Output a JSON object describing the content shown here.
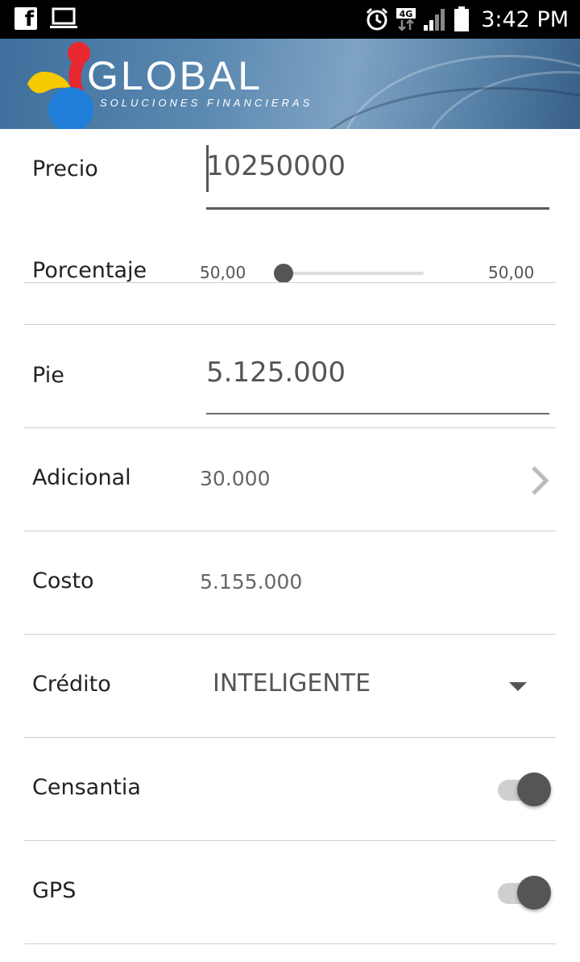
{
  "status_bar": {
    "time": "3:42 PM",
    "network": "4G",
    "icons": [
      "facebook-icon",
      "laptop-icon",
      "alarm-icon",
      "network-4g-icon",
      "signal-icon",
      "battery-icon"
    ]
  },
  "header": {
    "brand": "GLOBAL",
    "tagline": "SOLUCIONES FINANCIERAS",
    "colors": {
      "red": "#e8282f",
      "yellow": "#f6c900",
      "blue": "#1f7fd8"
    }
  },
  "form": {
    "precio": {
      "label": "Precio",
      "value": "10250000"
    },
    "porcentaje": {
      "label": "Porcentaje",
      "min": "50,00",
      "max": "50,00",
      "level": 0
    },
    "pie": {
      "label": "Pie",
      "value": "5.125.000"
    },
    "adicional": {
      "label": "Adicional",
      "value": "30.000"
    },
    "costo": {
      "label": "Costo",
      "value": "5.155.000"
    },
    "credito": {
      "label": "Crédito",
      "value": "INTELIGENTE"
    },
    "censantia": {
      "label": "Censantia",
      "on": true
    },
    "gps": {
      "label": "GPS",
      "on": true
    }
  }
}
